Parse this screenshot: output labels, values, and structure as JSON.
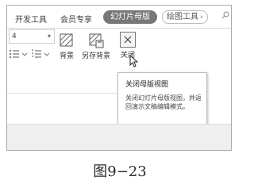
{
  "ribbon": {
    "tabs": {
      "developer": "开发工具",
      "member": "会员专享",
      "active": "幻灯片母版",
      "draw_tools": "绘图工具"
    },
    "draw_chevron": "›",
    "search_icon": "search-icon"
  },
  "toolbar": {
    "font_size_value": "4",
    "font_size_arrow": "▾",
    "background_label": "背景",
    "save_background_label": "另存背景",
    "close_label": "关闭"
  },
  "tooltip": {
    "title": "关闭母版视图",
    "body": "关闭幻灯片母版视图，并返回演示文稿编辑模式。"
  },
  "caption": "图9−23",
  "colors": {
    "active_tab_bg": "#777777",
    "border": "#a9a9a9",
    "footer_strip": "#efefef"
  }
}
